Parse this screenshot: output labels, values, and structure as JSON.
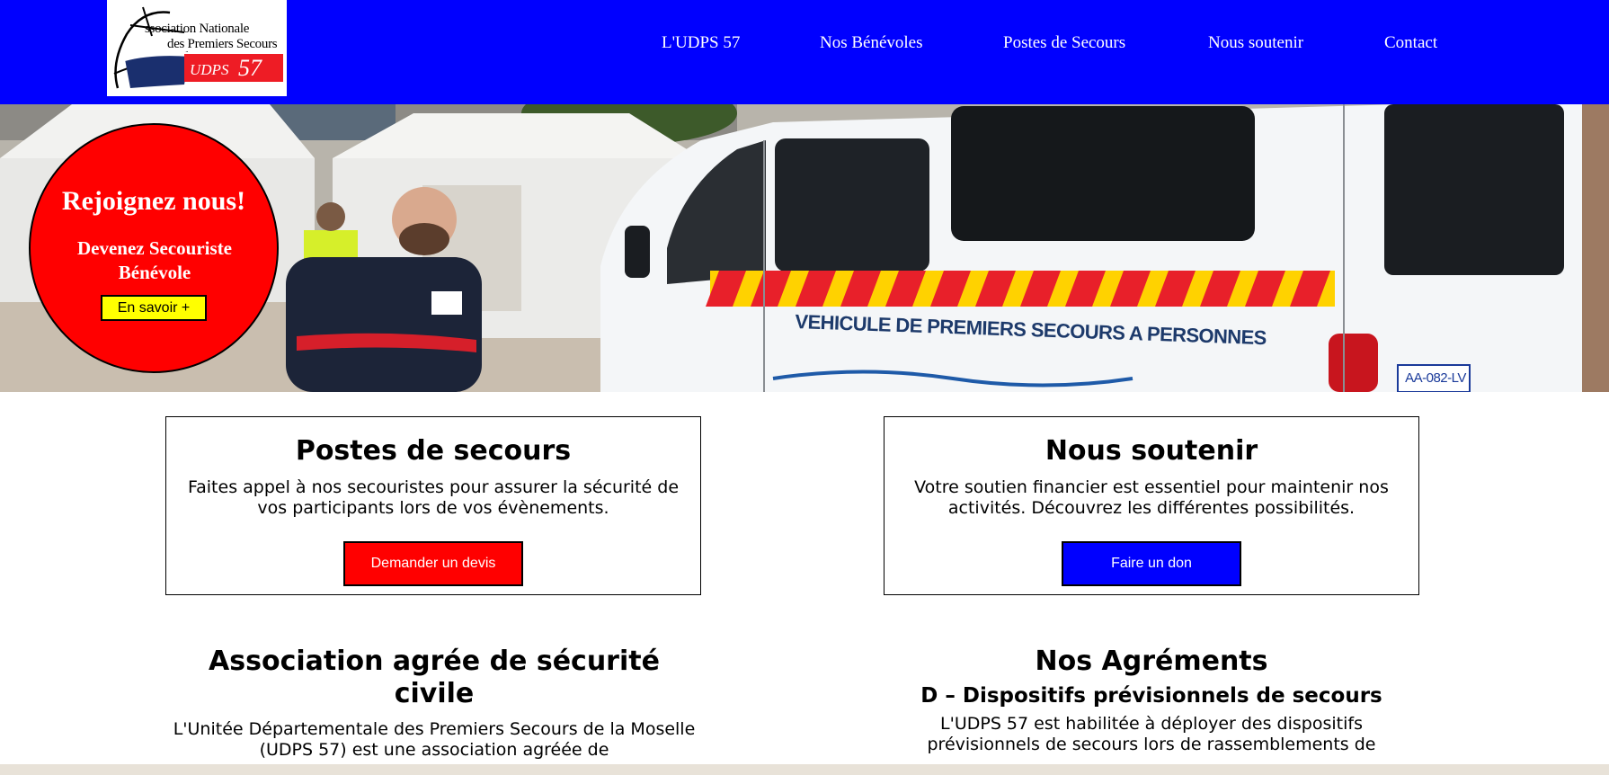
{
  "logo": {
    "line1": "ssociation Nationale",
    "line2": "des Premiers Secours",
    "udps_text": "UDPS",
    "udps_number": "57"
  },
  "nav": {
    "items": [
      {
        "label": "L'UDPS 57"
      },
      {
        "label": "Nos Bénévoles"
      },
      {
        "label": "Postes de Secours"
      },
      {
        "label": "Nous soutenir"
      },
      {
        "label": "Contact"
      }
    ]
  },
  "hero": {
    "van_text": "VEHICULE DE PREMIERS SECOURS A PERSONNES",
    "plate_text": "AA-082-LV",
    "join": {
      "title": "Rejoignez nous!",
      "subtitle": "Devenez Secouriste Bénévole",
      "button_label": "En savoir +"
    }
  },
  "cards": [
    {
      "title": "Postes de secours",
      "text": "Faites appel à nos secouristes pour assurer la sécurité de vos participants lors de vos évènements.",
      "button_label": "Demander un devis",
      "button_color": "#ff0000"
    },
    {
      "title": "Nous soutenir",
      "text": "Votre soutien financier est essentiel pour maintenir nos activités. Découvrez les différentes possibilités.",
      "button_label": "Faire un don",
      "button_color": "#0000ff"
    }
  ],
  "sections": {
    "association": {
      "title": "Association agrée de sécurité civile",
      "text": "L'Unitée Départementale des Premiers Secours de la Moselle (UDPS 57) est une association agréée de"
    },
    "agrements": {
      "title": "Nos Agréments",
      "subtitle": "D – Dispositifs prévisionnels de secours",
      "text": "L'UDPS 57 est habilitée à déployer des dispositifs prévisionnels de secours lors de rassemblements de"
    }
  },
  "colors": {
    "header_bg": "#0000ff",
    "join_bg": "#ff0000",
    "join_button_bg": "#ffff00"
  }
}
